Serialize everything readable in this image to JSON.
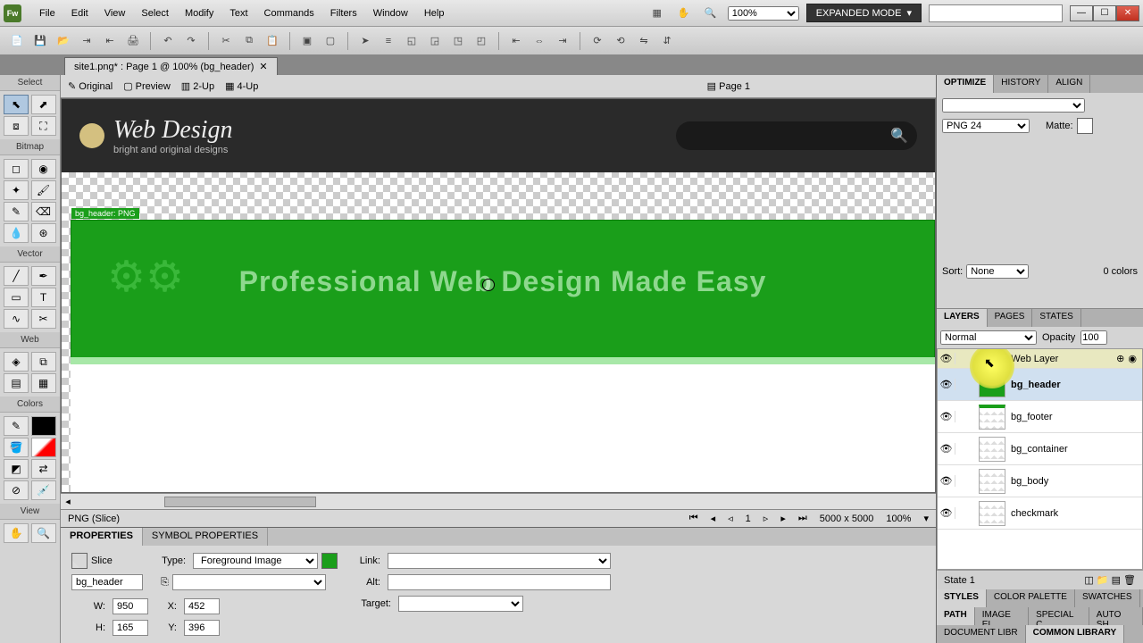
{
  "menu": {
    "file": "File",
    "edit": "Edit",
    "view": "View",
    "select": "Select",
    "modify": "Modify",
    "text": "Text",
    "commands": "Commands",
    "filters": "Filters",
    "window": "Window",
    "help": "Help"
  },
  "titlebar": {
    "zoom": "100%",
    "workspace": "EXPANDED MODE"
  },
  "doctab": {
    "label": "site1.png* : Page 1 @ 100% (bg_header)"
  },
  "tools": {
    "select": "Select",
    "bitmap": "Bitmap",
    "vector": "Vector",
    "web": "Web",
    "colors": "Colors",
    "view": "View"
  },
  "viewmodes": {
    "original": "Original",
    "preview": "Preview",
    "twoup": "2-Up",
    "fourup": "4-Up",
    "page": "Page 1"
  },
  "canvas": {
    "brand": "Web Design",
    "tagline": "bright and original designs",
    "slice_label": "bg_header: PNG",
    "headline": "Professional Web Design Made Easy"
  },
  "statusbar": {
    "type": "PNG (Slice)",
    "page": "1",
    "dims": "5000 x 5000",
    "zoom": "100%"
  },
  "props": {
    "tab1": "PROPERTIES",
    "tab2": "SYMBOL PROPERTIES",
    "slice": "Slice",
    "name": "bg_header",
    "type_label": "Type:",
    "type_value": "Foreground Image",
    "link_label": "Link:",
    "alt_label": "Alt:",
    "target_label": "Target:",
    "w_label": "W:",
    "w": "950",
    "x_label": "X:",
    "x": "452",
    "h_label": "H:",
    "h": "165",
    "y_label": "Y:",
    "y": "396"
  },
  "optimize": {
    "tab1": "OPTIMIZE",
    "tab2": "HISTORY",
    "tab3": "ALIGN",
    "format": "PNG 24",
    "matte": "Matte:",
    "sort_label": "Sort:",
    "sort_value": "None",
    "colors": "0 colors"
  },
  "layers": {
    "tab1": "LAYERS",
    "tab2": "PAGES",
    "tab3": "STATES",
    "blend": "Normal",
    "opacity_label": "Opacity",
    "opacity": "100",
    "weblayer": "Web Layer",
    "items": [
      "bg_header",
      "bg_footer",
      "bg_container",
      "bg_body",
      "checkmark"
    ],
    "state": "State 1"
  },
  "bottom_tabs": {
    "row1": [
      "STYLES",
      "COLOR PALETTE",
      "SWATCHES"
    ],
    "row2": [
      "PATH",
      "IMAGE EI",
      "SPECIAL C",
      "AUTO SH"
    ],
    "row3": [
      "DOCUMENT LIBR",
      "COMMON LIBRARY"
    ]
  }
}
